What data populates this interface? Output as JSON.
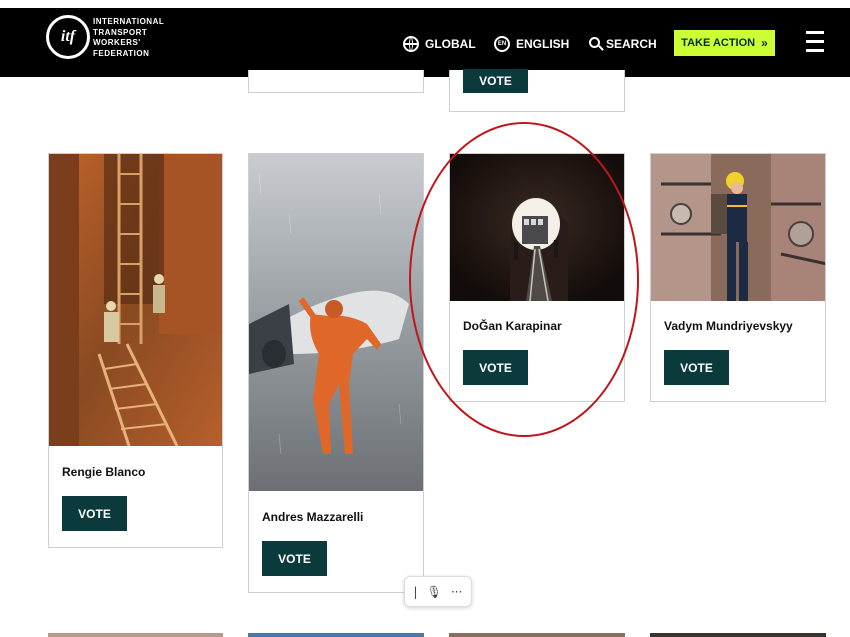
{
  "header": {
    "logo_mark": "itf",
    "logo_lines": [
      "INTERNATIONAL",
      "TRANSPORT",
      "WORKERS'",
      "FEDERATION"
    ],
    "nav": {
      "global": "GLOBAL",
      "language_icon_text": "EN",
      "english": "ENGLISH",
      "search": "SEARCH",
      "take_action": "TAKE ACTION",
      "take_action_arrow": "»"
    },
    "colors": {
      "bar": "#000000",
      "take_action_bg": "#ccff33",
      "take_action_text": "#002d33"
    }
  },
  "top_row": [
    {
      "vote_label": ""
    },
    {
      "vote_label": "VOTE"
    }
  ],
  "cards": [
    {
      "name": "Rengie Blanco",
      "vote_label": "VOTE"
    },
    {
      "name": "Andres Mazzarelli",
      "vote_label": "VOTE"
    },
    {
      "name": "DoĞan Karapinar",
      "vote_label": "VOTE",
      "highlighted": true
    },
    {
      "name": "Vadym Mundriyevskyy",
      "vote_label": "VOTE"
    }
  ],
  "colors": {
    "vote_button": "#0b3a3c",
    "highlight": "#c0161b"
  },
  "mini_toolbar": {
    "cursor": "|",
    "mic": "🎙",
    "more": "···"
  }
}
